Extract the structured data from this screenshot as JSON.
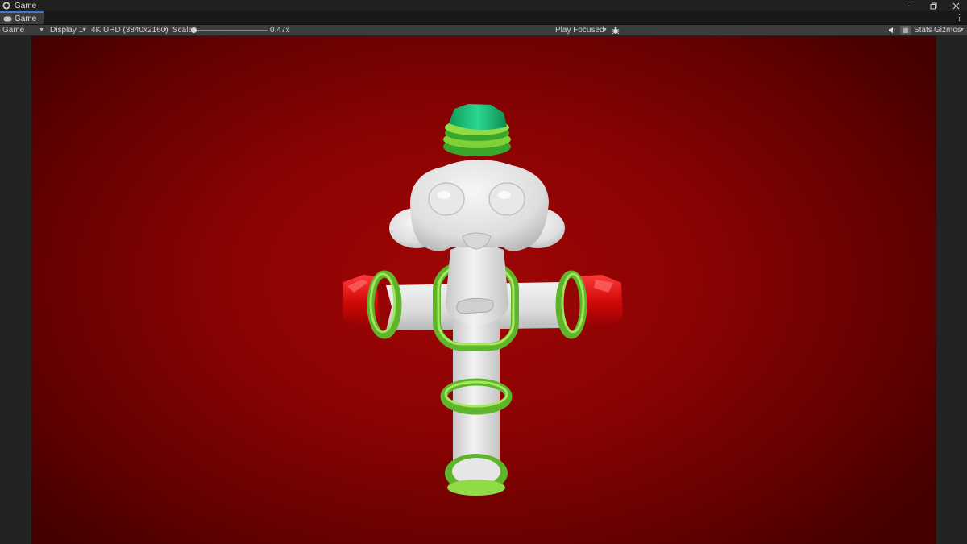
{
  "window": {
    "title": "Game"
  },
  "tab": {
    "label": "Game"
  },
  "toolbar": {
    "view_mode": "Game",
    "display": "Display 1",
    "resolution": "4K UHD (3840x2160)",
    "scale_label": "Scale",
    "scale_value": "0.47x",
    "play_mode": "Play Focused",
    "stats_label": "Stats",
    "gizmos_label": "Gizmos"
  },
  "icons": {
    "app": "unity-logo-icon",
    "tab": "gamepad-icon",
    "bug": "bug-icon",
    "audio": "speaker-icon",
    "grid": "grid-icon",
    "menu": "kebab-menu-icon"
  },
  "colors": {
    "background_center": "#a00606",
    "background_edge": "#460000",
    "ring_green": "#7fd13a",
    "cap_green": "#1ec07a",
    "end_red": "#d30808",
    "body_white": "#e6e6e6",
    "tab_accent": "#3a7bd5"
  }
}
